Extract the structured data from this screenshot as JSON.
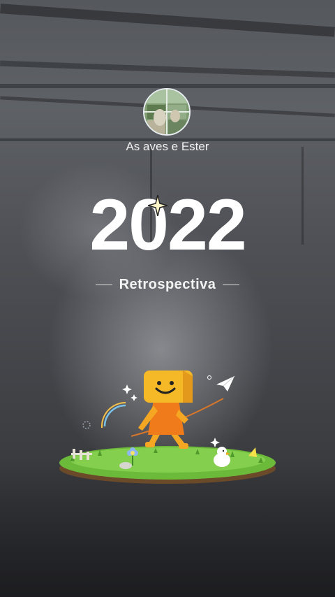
{
  "profile": {
    "name": "As aves e Ester",
    "avatar_icon": "profile-photo-icon"
  },
  "banner": {
    "year": "2022",
    "subtitle": "Retrospectiva"
  },
  "colors": {
    "background": "#4f5156",
    "title_text": "#ffffff",
    "mascot_head": "#f5a623",
    "mascot_body": "#f07b1a",
    "grass": "#6cba3a"
  },
  "illustration": {
    "icons": [
      "mascot-icon",
      "paper-plane-icon",
      "duck-icon",
      "flower-icon",
      "sparkle-icon"
    ]
  }
}
